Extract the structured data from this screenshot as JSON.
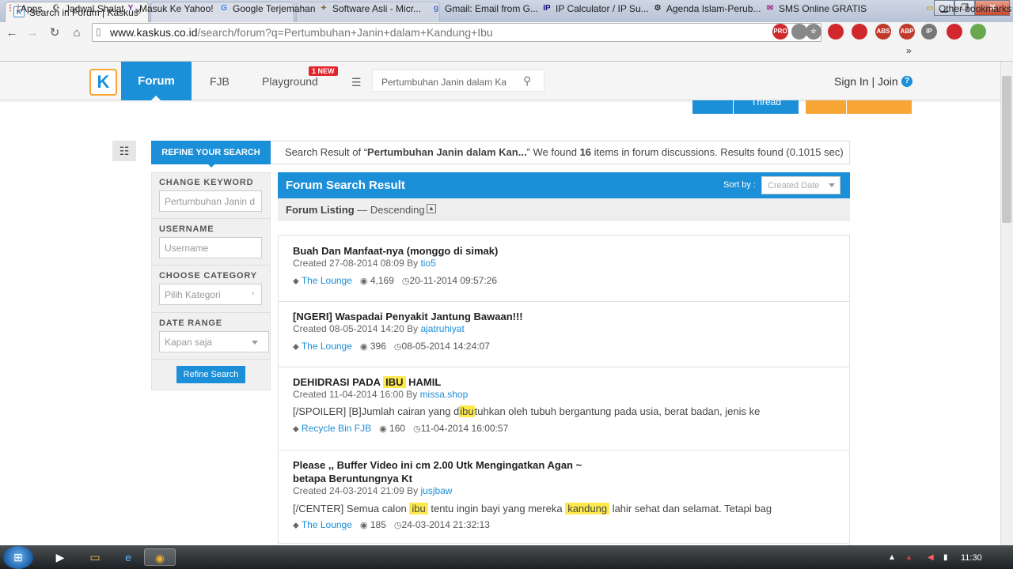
{
  "browser": {
    "active_tab_title": "Search in Forum | Kaskus",
    "inactive_tab_title": "",
    "favicon_text": "K",
    "url_host": "www.kaskus.co.id",
    "url_path": "/search/forum?q=Pertumbuhan+Janin+dalam+Kandung+Ibu",
    "extensions": [
      {
        "name": "pro-extension-icon",
        "label": "PRO",
        "color": "#d0282c"
      },
      {
        "name": "translate-extension-icon",
        "label": "",
        "color": "#888888"
      },
      {
        "name": "star-bookmark-icon",
        "label": "☆",
        "color": "#888888"
      },
      {
        "name": "red-extension-1-icon",
        "label": "",
        "color": "#d0282c"
      },
      {
        "name": "red-extension-2-icon",
        "label": "",
        "color": "#d0282c"
      },
      {
        "name": "abs-extension-icon",
        "label": "ABS",
        "color": "#c0392b"
      },
      {
        "name": "abp-extension-icon",
        "label": "ABP",
        "color": "#c0392b"
      },
      {
        "name": "ip-extension-icon",
        "label": "IP",
        "color": "#777777"
      },
      {
        "name": "block-extension-icon",
        "label": "",
        "color": "#d0282c"
      },
      {
        "name": "green-extension-icon",
        "label": "",
        "color": "#6aa84f"
      }
    ]
  },
  "bookmarks": [
    {
      "label": "Apps",
      "icon": "apps-icon",
      "glyph": "⋮⋮",
      "color": "#c0392b"
    },
    {
      "label": "Jadwal Shalat",
      "icon": "mosque-icon",
      "glyph": "☪",
      "color": "#555555"
    },
    {
      "label": "Masuk Ke Yahoo!",
      "icon": "yahoo-icon",
      "glyph": "Y",
      "color": "#6b2fa0"
    },
    {
      "label": "Google Terjemahan",
      "icon": "translate-icon",
      "glyph": "G",
      "color": "#4285f4"
    },
    {
      "label": "Software Asli - Micr...",
      "icon": "software-icon",
      "glyph": "✦",
      "color": "#8a6d3b"
    },
    {
      "label": "Gmail: Email from G...",
      "icon": "gmail-icon",
      "glyph": "g",
      "color": "#4a6cd4"
    },
    {
      "label": "IP Calculator / IP Su...",
      "icon": "ip-icon",
      "glyph": "IP",
      "color": "#111177"
    },
    {
      "label": "Agenda Islam-Perub...",
      "icon": "gear-icon",
      "glyph": "⚙",
      "color": "#333333"
    },
    {
      "label": "SMS Online GRATIS",
      "icon": "sms-icon",
      "glyph": "✉",
      "color": "#9b2d8a"
    },
    {
      "label": "Other bookmarks",
      "icon": "folder-icon",
      "glyph": "▭",
      "color": "#c9a23a"
    }
  ],
  "bookmarks_overflow": "»",
  "header": {
    "logo_text": "K",
    "nav_forum": "Forum",
    "nav_fjb": "FJB",
    "nav_playground": "Playground",
    "new_badge": "1 NEW",
    "search_value": "Pertumbuhan Janin dalam Ka",
    "sign_in": "Sign In",
    "separator": "|",
    "join": "Join",
    "help": "?"
  },
  "hidden_buttons": {
    "thread": "Thread"
  },
  "refine": {
    "tab_label": "REFINE YOUR SEARCH",
    "summary_prefix": "Search Result of “",
    "summary_query": "Pertumbuhan Janin dalam Kan...",
    "summary_mid": "” We found ",
    "summary_count": "16",
    "summary_suffix": " items in forum discussions. Results found (0.1015 sec)",
    "change_keyword_label": "CHANGE KEYWORD",
    "keyword_value": "Pertumbuhan Janin d",
    "username_label": "USERNAME",
    "username_placeholder": "Username",
    "category_label": "CHOOSE CATEGORY",
    "category_value": "Pilih Kategori",
    "date_label": "DATE RANGE",
    "date_value": "Kapan saja",
    "refine_button": "Refine Search"
  },
  "results": {
    "title": "Forum Search Result",
    "sort_label": "Sort by :",
    "sort_value": "Created Date",
    "listing_label": "Forum Listing",
    "listing_order": "— Descending",
    "items": [
      {
        "title": "Buah Dan Manfaat-nya (monggo di simak)",
        "created": "Created 27-08-2014 08:09 By ",
        "author": "tio5",
        "snippet": null,
        "category": "The Lounge",
        "views": "4,169",
        "last": "20-11-2014 09:57:26"
      },
      {
        "title": "[NGERI] Waspadai Penyakit Jantung Bawaan!!!",
        "created": "Created 08-05-2014 14:20 By ",
        "author": "ajatruhiyat",
        "snippet": null,
        "category": "The Lounge",
        "views": "396",
        "last": "08-05-2014 14:24:07"
      },
      {
        "title_parts": [
          "DEHIDRASI PADA ",
          "IBU",
          " HAMIL"
        ],
        "created": "Created 11-04-2014 16:00 By ",
        "author": "missa.shop",
        "snippet_parts": [
          "[/SPOILER] [B]Jumlah cairan yang d",
          "ibu",
          "tuhkan oleh tubuh bergantung pada usia, berat badan, jenis ke"
        ],
        "category": "Recycle Bin FJB",
        "views": "160",
        "last": "11-04-2014 16:00:57"
      },
      {
        "title_line1": "Please ,, Buffer Video ini cm 2.00 Utk Mengingatkan Agan ~",
        "title_line2": "betapa Beruntungnya Kt",
        "created": "Created 24-03-2014 21:09 By ",
        "author": "jusjbaw",
        "snippet_parts": [
          "[/CENTER] Semua calon ",
          "ibu",
          " tentu ingin bayi yang mereka ",
          "kandung",
          " lahir sehat dan selamat. Tetapi bag"
        ],
        "category": "The Lounge",
        "views": "185",
        "last": "24-03-2014 21:32:13"
      }
    ]
  },
  "taskbar": {
    "clock": "11:30"
  }
}
